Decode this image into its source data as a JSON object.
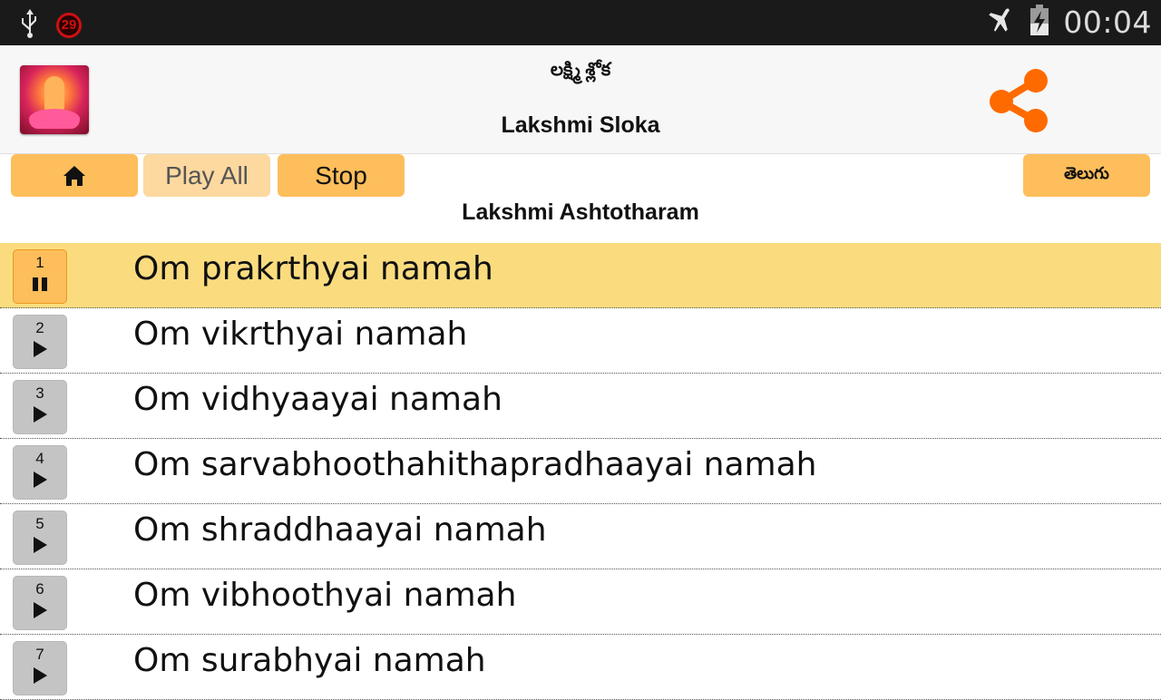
{
  "status_bar": {
    "left_icons": [
      "usb-icon",
      "notification-badge-icon"
    ],
    "badge_count": "29",
    "right_icons": [
      "airplane-mode-icon",
      "battery-charging-icon"
    ],
    "time": "00:04"
  },
  "header": {
    "title_telugu": "లక్ష్మి శ్లోక",
    "title": "Lakshmi Sloka",
    "logo_icon": "lakshmi-logo",
    "share_icon": "share-icon",
    "accent_color": "#ff6a00"
  },
  "toolbar": {
    "home_icon": "home-icon",
    "play_all_label": "Play All",
    "stop_label": "Stop",
    "language_label": "తెలుగు",
    "button_color": "#fdbe5b"
  },
  "section_title": "Lakshmi Ashtotharam",
  "list": {
    "items": [
      {
        "number": "1",
        "text": "Om prakrthyai namah",
        "state": "playing"
      },
      {
        "number": "2",
        "text": "Om vikrthyai namah",
        "state": "idle"
      },
      {
        "number": "3",
        "text": "Om vidhyaayai namah",
        "state": "idle"
      },
      {
        "number": "4",
        "text": "Om sarvabhoothahithapradhaayai namah",
        "state": "idle"
      },
      {
        "number": "5",
        "text": "Om shraddhaayai namah",
        "state": "idle"
      },
      {
        "number": "6",
        "text": "Om vibhoothyai namah",
        "state": "idle"
      },
      {
        "number": "7",
        "text": "Om surabhyai namah",
        "state": "idle"
      }
    ],
    "active_color": "#fadc7f"
  }
}
